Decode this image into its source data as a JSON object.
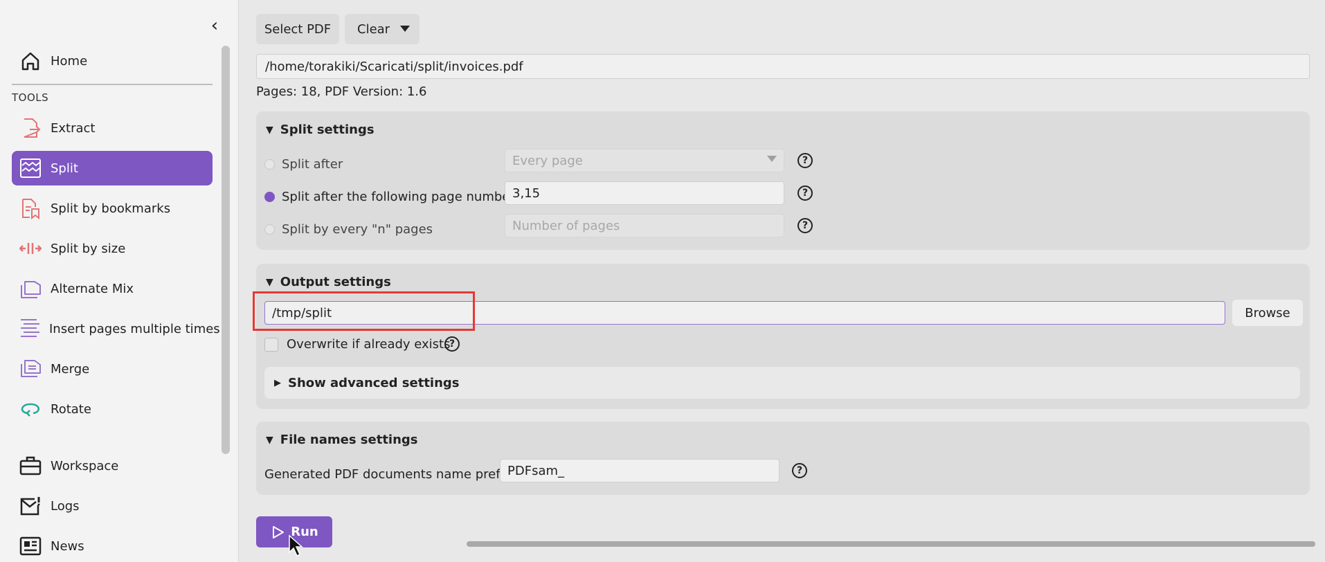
{
  "sidebar": {
    "home_label": "Home",
    "tools_label": "TOOLS",
    "items": [
      {
        "label": "Extract",
        "icon": "extract-icon"
      },
      {
        "label": "Split",
        "icon": "split-icon"
      },
      {
        "label": "Split by bookmarks",
        "icon": "bookmark-split-icon"
      },
      {
        "label": "Split by size",
        "icon": "size-split-icon"
      },
      {
        "label": "Alternate Mix",
        "icon": "alternate-mix-icon"
      },
      {
        "label": "Insert pages multiple times",
        "icon": "insert-pages-icon"
      },
      {
        "label": "Merge",
        "icon": "merge-icon"
      },
      {
        "label": "Rotate",
        "icon": "rotate-icon"
      }
    ],
    "bottom": [
      {
        "label": "Workspace",
        "icon": "briefcase-icon"
      },
      {
        "label": "Logs",
        "icon": "logs-icon"
      },
      {
        "label": "News",
        "icon": "news-icon"
      }
    ],
    "active_color": "#7e57c2"
  },
  "toolbar": {
    "select_pdf": "Select PDF",
    "clear": "Clear"
  },
  "file": {
    "path": "/home/torakiki/Scaricati/split/invoices.pdf",
    "info": "Pages: 18, PDF Version: 1.6"
  },
  "split_settings": {
    "title": "Split settings",
    "opt1_label": "Split after",
    "opt1_value": "Every page",
    "opt2_label": "Split after the following page numbers",
    "opt2_value": "3,15",
    "opt3_label": "Split by every \"n\" pages",
    "opt3_placeholder": "Number of pages"
  },
  "output_settings": {
    "title": "Output settings",
    "dir": "/tmp/split",
    "browse": "Browse",
    "overwrite": "Overwrite if already exists",
    "advanced": "Show advanced settings"
  },
  "file_names": {
    "title": "File names settings",
    "prefix_label": "Generated PDF documents name prefix:",
    "prefix_value": "PDFsam_"
  },
  "run_label": "Run"
}
